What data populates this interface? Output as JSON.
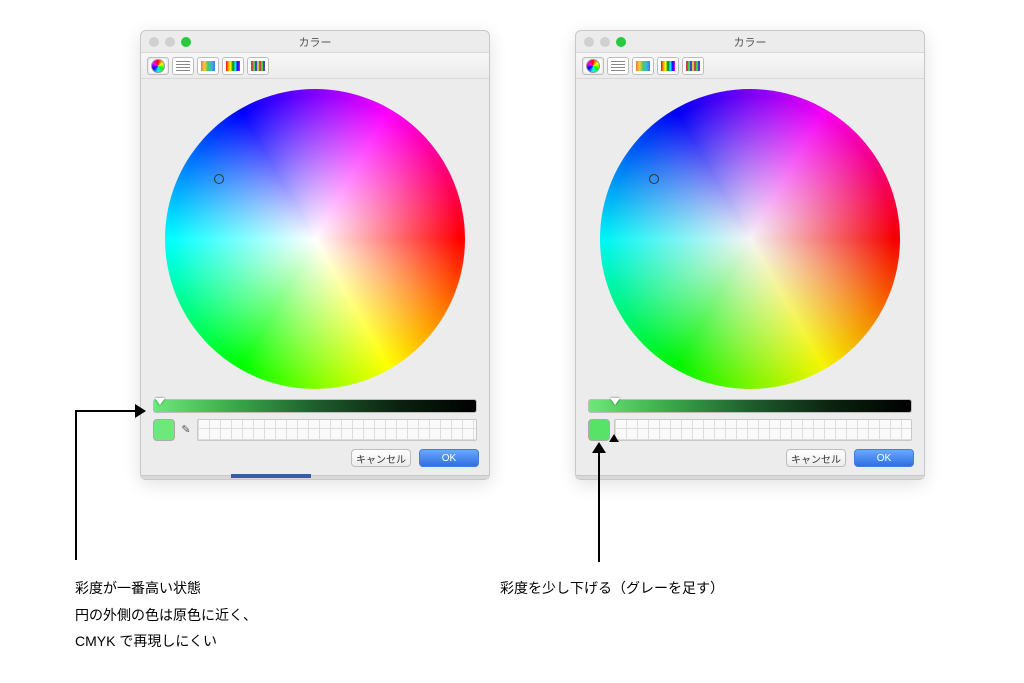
{
  "window_title": "カラー",
  "buttons": {
    "cancel": "キャンセル",
    "ok": "OK"
  },
  "panels": {
    "left": {
      "swatch_color": "#6de87a",
      "slider_thumb_percent": 2,
      "wheel_cursor": {
        "left_pct": 18,
        "top_pct": 30
      }
    },
    "right": {
      "swatch_color": "#57e268",
      "slider_thumb_percent": 8,
      "wheel_cursor": {
        "left_pct": 18,
        "top_pct": 30
      },
      "has_black_override_thumb": true
    }
  },
  "captions": {
    "left_lines": [
      "彩度が一番高い状態",
      "円の外側の色は原色に近く、",
      "CMYK で再現しにくい"
    ],
    "right_line": "彩度を少し下げる（グレーを足す）"
  },
  "icons": {
    "wheel": "color-wheel-icon",
    "sliders": "sliders-icon",
    "palette": "palette-icon",
    "spectrum": "spectrum-icon",
    "pencils": "pencils-icon",
    "eyedropper": "✎"
  }
}
